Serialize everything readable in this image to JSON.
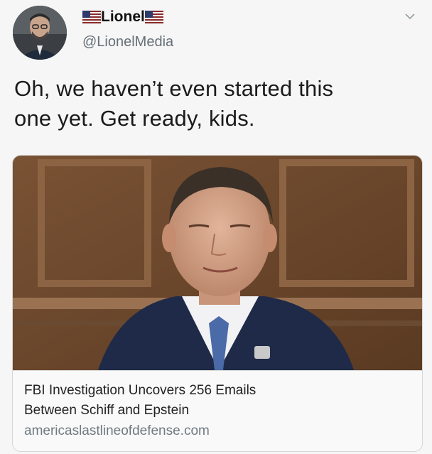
{
  "tweet": {
    "display_name": "Lionel",
    "handle": "@LionelMedia",
    "text_line1": "Oh, we haven’t even started this",
    "text_line2": "one yet. Get ready, kids.",
    "avatar_icon": "user-avatar-photo",
    "menu_icon": "chevron-down-icon",
    "flag_icon": "us-flag-icon"
  },
  "card": {
    "title_line1": "FBI Investigation Uncovers 256 Emails",
    "title_line2": "Between Schiff and Epstein",
    "domain": "americaslastlineofdefense.com",
    "image_icon": "news-photo"
  },
  "colors": {
    "background": "#f6f6f6",
    "handle_gray": "#667077",
    "border": "#d6d6d6"
  }
}
